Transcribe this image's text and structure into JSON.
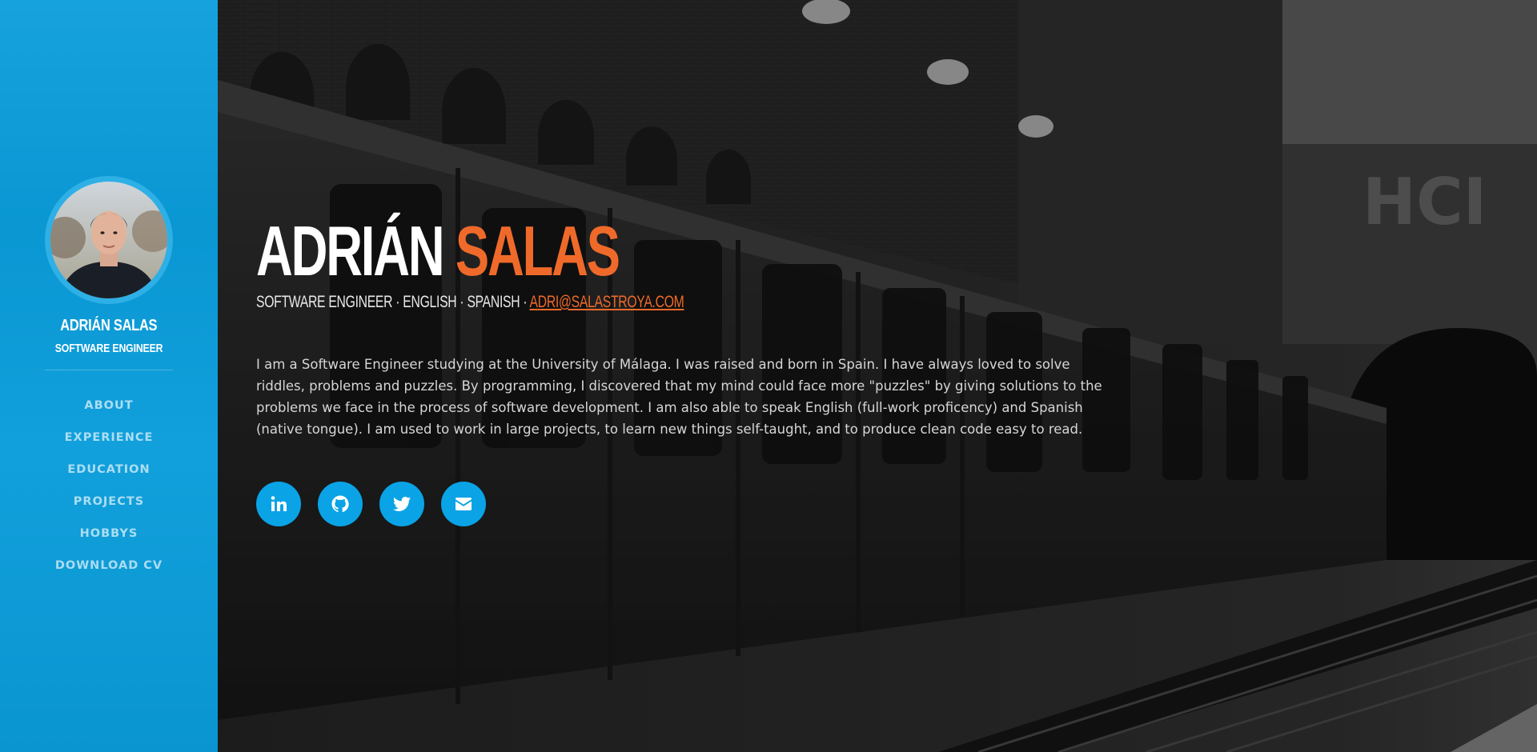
{
  "sidebar": {
    "name": "ADRIÁN SALAS",
    "role": "SOFTWARE ENGINEER",
    "nav": [
      {
        "label": "ABOUT"
      },
      {
        "label": "EXPERIENCE"
      },
      {
        "label": "EDUCATION"
      },
      {
        "label": "PROJECTS"
      },
      {
        "label": "HOBBYS"
      },
      {
        "label": "DOWNLOAD CV"
      }
    ]
  },
  "hero": {
    "first_name": "ADRIÁN",
    "last_name": "SALAS",
    "subtitle_prefix": "SOFTWARE ENGINEER · ENGLISH · SPANISH · ",
    "email": "ADRI@SALASTROYA.COM",
    "about": "I am a Software Engineer studying at the University of Málaga. I was raised and born in Spain. I have always loved to solve riddles, problems and puzzles. By programming, I discovered that my mind could face more \"puzzles\" by giving solutions to the problems we face in the process of software development. I am also able to speak English (full-work proficency) and Spanish (native tongue). I am used to work in large projects, to learn new things self-taught, and to produce clean code easy to read.",
    "socials": [
      {
        "icon": "linkedin-icon"
      },
      {
        "icon": "github-icon"
      },
      {
        "icon": "twitter-icon"
      },
      {
        "icon": "envelope-icon"
      }
    ]
  },
  "colors": {
    "sidebar_bg": "#0a9ddb",
    "accent": "#ef6a2a",
    "social_bg": "#0aa3e6"
  }
}
